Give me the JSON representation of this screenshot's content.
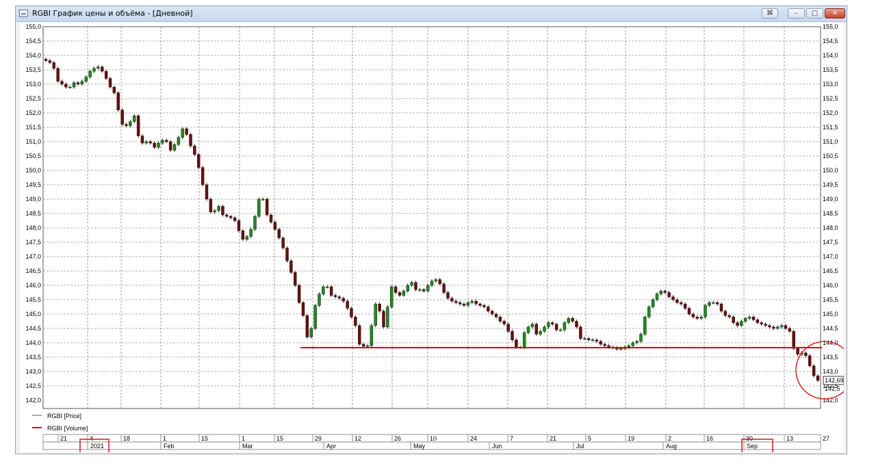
{
  "window": {
    "title": "RGBI График цены и объёма - [Дневной]",
    "buttons": {
      "special": "⌘",
      "minimize": "–",
      "maximize": "□",
      "close": "✕"
    }
  },
  "colors": {
    "up_candle": "#1f8b1f",
    "down_candle": "#6b0f0f",
    "support_line": "#dd0000",
    "annotation_box": "#dd2222",
    "grid": "#666666"
  },
  "chart_data": {
    "type": "candlestick",
    "title": "",
    "ylim": [
      141.5,
      155.0
    ],
    "y_ticks": [
      "155,0",
      "154,5",
      "154,0",
      "153,5",
      "153,0",
      "152,5",
      "152,0",
      "151,5",
      "151,0",
      "150,5",
      "150,0",
      "149,5",
      "149,0",
      "148,5",
      "148,0",
      "147,5",
      "147,0",
      "146,5",
      "146,0",
      "145,5",
      "145,0",
      "144,5",
      "144,0",
      "143,5",
      "143,0",
      "142,5",
      "142,0"
    ],
    "last_price_label": "142,69",
    "right_stub_label": "142,5",
    "date_ticks_top": [
      "21",
      "4",
      "18",
      "1",
      "15",
      "1",
      "15",
      "29",
      "12",
      "26",
      "10",
      "24",
      "7",
      "21",
      "5",
      "19",
      "2",
      "16",
      "30",
      "13",
      "27"
    ],
    "date_ticks_bottom": [
      "2021",
      "Feb",
      "Mar",
      "Apr",
      "May",
      "Jun",
      "Jul",
      "Aug",
      "Sep"
    ],
    "highlighted_labels": [
      "2021",
      "Sep"
    ],
    "support_level": 143.83,
    "legend": [
      "RGBI [Price]",
      "RGBI [Volume]"
    ],
    "grid": true,
    "candle_closes": [
      153.82,
      153.75,
      153.55,
      153.1,
      153.0,
      152.9,
      152.9,
      153.05,
      153.0,
      153.1,
      153.25,
      153.45,
      153.55,
      153.6,
      153.45,
      153.2,
      152.9,
      152.7,
      152.1,
      151.6,
      151.55,
      151.7,
      151.9,
      151.2,
      150.95,
      151.0,
      150.95,
      150.8,
      150.95,
      151.05,
      151.0,
      150.7,
      150.9,
      151.15,
      151.45,
      151.25,
      150.85,
      150.55,
      150.1,
      149.5,
      149.0,
      148.55,
      148.6,
      148.75,
      148.45,
      148.4,
      148.35,
      148.25,
      147.9,
      147.6,
      147.7,
      147.95,
      148.4,
      149.0,
      149.0,
      148.45,
      148.2,
      147.95,
      147.65,
      147.3,
      146.85,
      146.45,
      146.0,
      145.4,
      144.95,
      144.2,
      144.5,
      145.3,
      145.7,
      145.95,
      145.95,
      145.65,
      145.6,
      145.55,
      145.45,
      145.2,
      144.9,
      144.6,
      143.95,
      143.88,
      143.9,
      144.6,
      145.35,
      145.1,
      144.55,
      145.25,
      145.95,
      145.75,
      145.65,
      145.8,
      146.0,
      146.1,
      145.85,
      145.85,
      145.8,
      146.0,
      146.15,
      146.2,
      146.05,
      145.75,
      145.55,
      145.45,
      145.4,
      145.35,
      145.3,
      145.4,
      145.45,
      145.35,
      145.3,
      145.25,
      145.1,
      145.0,
      144.9,
      144.75,
      144.65,
      144.4,
      144.1,
      143.85,
      143.85,
      144.35,
      144.55,
      144.65,
      144.3,
      144.4,
      144.55,
      144.7,
      144.65,
      144.45,
      144.45,
      144.7,
      144.85,
      144.75,
      144.55,
      144.15,
      144.15,
      144.1,
      144.1,
      144.05,
      143.95,
      143.9,
      143.85,
      143.83,
      143.78,
      143.8,
      143.85,
      143.9,
      144.0,
      144.05,
      144.3,
      144.9,
      145.25,
      145.5,
      145.7,
      145.8,
      145.75,
      145.6,
      145.5,
      145.4,
      145.35,
      145.2,
      145.0,
      144.9,
      144.85,
      144.9,
      145.3,
      145.4,
      145.4,
      145.35,
      145.1,
      144.95,
      144.9,
      144.7,
      144.6,
      144.75,
      144.85,
      144.9,
      144.8,
      144.7,
      144.65,
      144.6,
      144.55,
      144.5,
      144.55,
      144.6,
      144.5,
      144.4,
      143.8,
      143.6,
      143.65,
      143.55,
      143.2,
      142.85,
      142.69
    ]
  }
}
